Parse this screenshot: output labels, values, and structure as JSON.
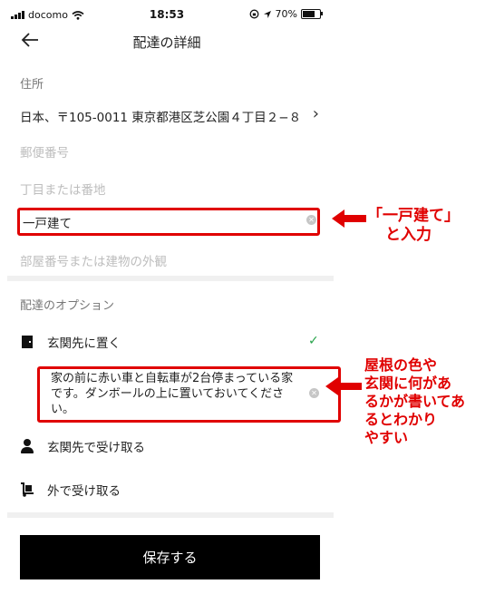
{
  "status_bar": {
    "carrier": "docomo",
    "time": "18:53",
    "battery": "70%",
    "battery_level": 0.7
  },
  "header": {
    "title": "配達の詳細",
    "back_icon": "arrow-left-icon"
  },
  "address": {
    "section_label": "住所",
    "full_address": "日本、〒105-0011 東京都港区芝公園４丁目２−８",
    "postal_placeholder": "郵便番号",
    "block_placeholder": "丁目または番地",
    "building_value": "一戸建て",
    "room_placeholder": "部屋番号または建物の外観"
  },
  "options": {
    "section_label": "配達のオプション",
    "items": [
      {
        "label": "玄関先に置く",
        "icon": "door-icon",
        "selected": true
      },
      {
        "label": "玄関先で受け取る",
        "icon": "person-icon",
        "selected": false
      },
      {
        "label": "外で受け取る",
        "icon": "hand-truck-icon",
        "selected": false
      }
    ],
    "note_text": "家の前に赤い車と自転車が2台停まっている家です。ダンボールの上に置いておいてください。"
  },
  "save_button": {
    "label": "保存する"
  },
  "annotations": {
    "building_note": [
      "「一戸建て」",
      "と入力"
    ],
    "note_note": [
      "屋根の色や",
      "玄関に何があ",
      "るかが書いてあ",
      "るとわかり",
      "やすい"
    ],
    "accent": "#e00000"
  }
}
